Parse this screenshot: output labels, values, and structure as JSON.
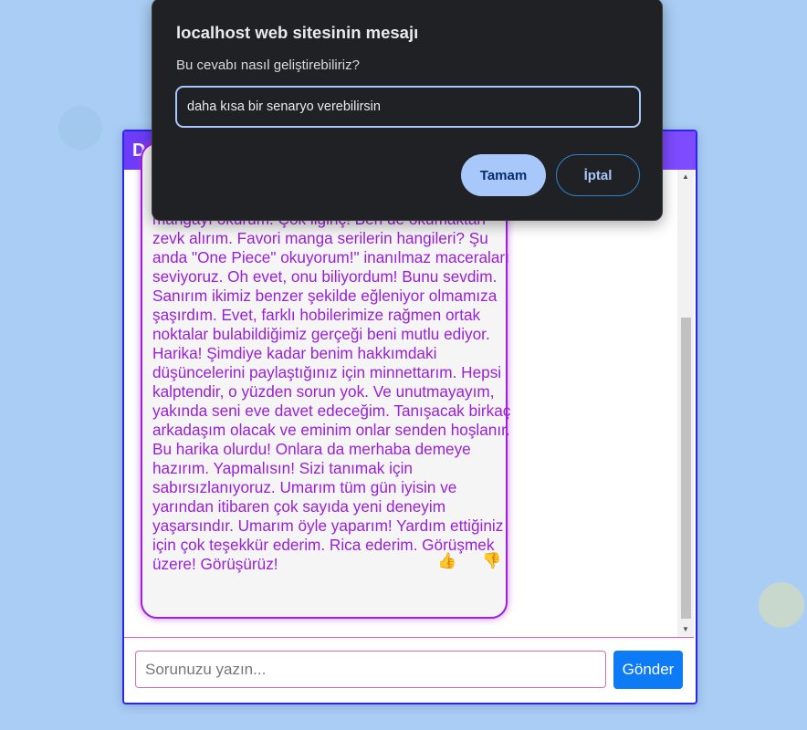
{
  "dialog": {
    "title": "localhost web sitesinin mesajı",
    "message": "Bu cevabı nasıl geliştirebiliriz?",
    "input_value": "daha kısa bir senaryo verebilirsin",
    "ok_label": "Tamam",
    "cancel_label": "İptal"
  },
  "chat": {
    "header_visible_title": "Du",
    "message_text": "Peki, ben genellikle çizgi filmleri izlemeyi severim ve mangayı okurum. Çok ilginç! Ben de okumaktan zevk alırım. Favori manga serilerin hangileri? Şu anda \"One Piece\" okuyorum!\" inanılmaz maceraları seviyoruz. Oh evet, onu biliyordum! Bunu sevdim. Sanırım ikimiz benzer şekilde eğleniyor olmamıza şaşırdım. Evet, farklı hobilerimize rağmen ortak noktalar bulabildiğimiz gerçeği beni mutlu ediyor. Harika! Şimdiye kadar benim hakkımdaki düşüncelerini paylaştığınız için minnettarım. Hepsi kalptendir, o yüzden sorun yok. Ve unutmayayım, yakında seni eve davet edeceğim. Tanışacak birkaç arkadaşım olacak ve eminim onlar senden hoşlanır. Bu harika olurdu! Onlara da merhaba demeye hazırım. Yapmalısın! Sizi tanımak için sabırsızlanıyoruz. Umarım tüm gün iyisin ve yarından itibaren çok sayıda yeni deneyim yaşarsındır. Umarım öyle yaparım! Yardım ettiğiniz için çok teşekkür ederim. Rica ederim. Görüşmek üzere! Görüşürüz!",
    "thumbs_up": "👍",
    "thumbs_down": "👎",
    "input_placeholder": "Sorunuzu yazın...",
    "send_label": "Gönder"
  },
  "colors": {
    "page_background": "#a9cdf4",
    "header_gradient_start": "#6d3cf7",
    "message_text": "#9b1fd6",
    "send_button": "#0e7bf6",
    "dialog_background": "#202124",
    "dialog_accent": "#a8c7fa"
  }
}
